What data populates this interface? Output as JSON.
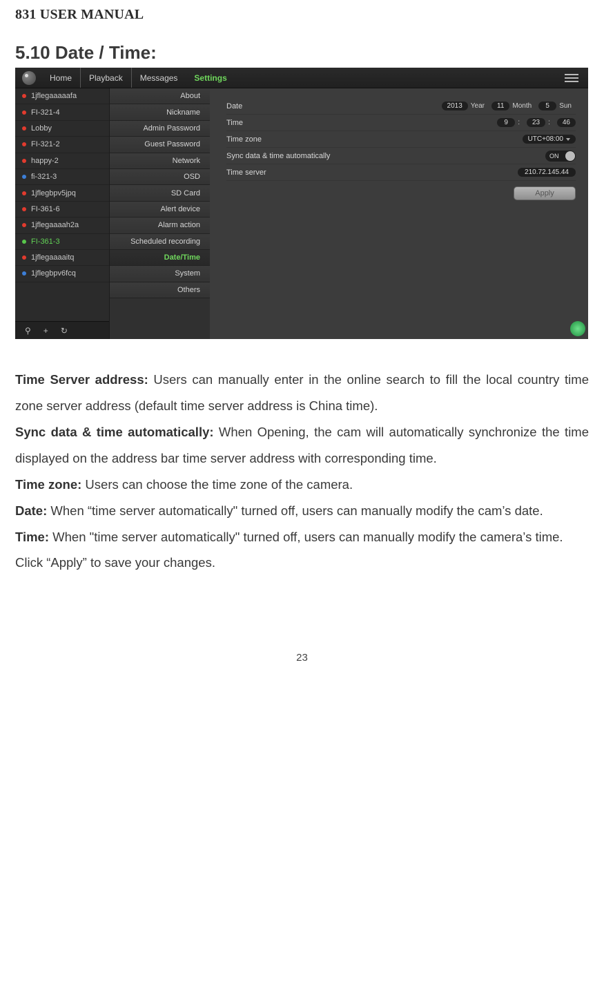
{
  "doc_header": "831 USER MANUAL",
  "section_title": "5.10 Date / Time:",
  "topnav": {
    "home": "Home",
    "playback": "Playback",
    "messages": "Messages",
    "settings": "Settings"
  },
  "cameras": [
    {
      "name": "1jflegaaaaafa",
      "status": "red"
    },
    {
      "name": "FI-321-4",
      "status": "red"
    },
    {
      "name": "Lobby",
      "status": "red"
    },
    {
      "name": "FI-321-2",
      "status": "red"
    },
    {
      "name": "happy-2",
      "status": "red"
    },
    {
      "name": "fi-321-3",
      "status": "blue"
    },
    {
      "name": "1jflegbpv5jpq",
      "status": "red"
    },
    {
      "name": "FI-361-6",
      "status": "red"
    },
    {
      "name": "1jflegaaaah2a",
      "status": "red"
    },
    {
      "name": "FI-361-3",
      "status": "green",
      "selected": true
    },
    {
      "name": "1jflegaaaaitq",
      "status": "red"
    },
    {
      "name": "1jflegbpv6fcq",
      "status": "blue"
    }
  ],
  "settings_menu": [
    "About",
    "Nickname",
    "Admin Password",
    "Guest Password",
    "Network",
    "OSD",
    "SD Card",
    "Alert device",
    "Alarm action",
    "Scheduled recording",
    "Date/Time",
    "System",
    "Others"
  ],
  "settings_active": "Date/Time",
  "rows": {
    "date_label": "Date",
    "date": {
      "year": "2013",
      "year_u": "Year",
      "month": "11",
      "month_u": "Month",
      "day": "5",
      "day_u": "Sun"
    },
    "time_label": "Time",
    "time": {
      "h": "9",
      "m": "23",
      "s": "46"
    },
    "tz_label": "Time zone",
    "tz_value": "UTC+08:00",
    "sync_label": "Sync data & time automatically",
    "sync_on": "ON",
    "server_label": "Time server",
    "server_value": "210.72.145.44",
    "apply": "Apply"
  },
  "body": {
    "p1_b": "Time Server address:",
    "p1": " Users can manually enter in the online search to fill the local country time zone server address (default time server address is China time).",
    "p2_b": "Sync data & time automatically:",
    "p2": " When Opening, the cam will automatically synchronize the time displayed on the address bar time server address with corresponding time.",
    "p3_b": "Time zone:",
    "p3": " Users can choose the time zone of the camera.",
    "p4_b": "Date:",
    "p4": " When “time server automatically\" turned off, users can manually modify the cam’s date.",
    "p5_b": "Time:",
    "p5": " When \"time server automatically\" turned off, users can manually modify the camera’s time.",
    "p6": "Click “Apply” to save your changes."
  },
  "page_number": "23"
}
